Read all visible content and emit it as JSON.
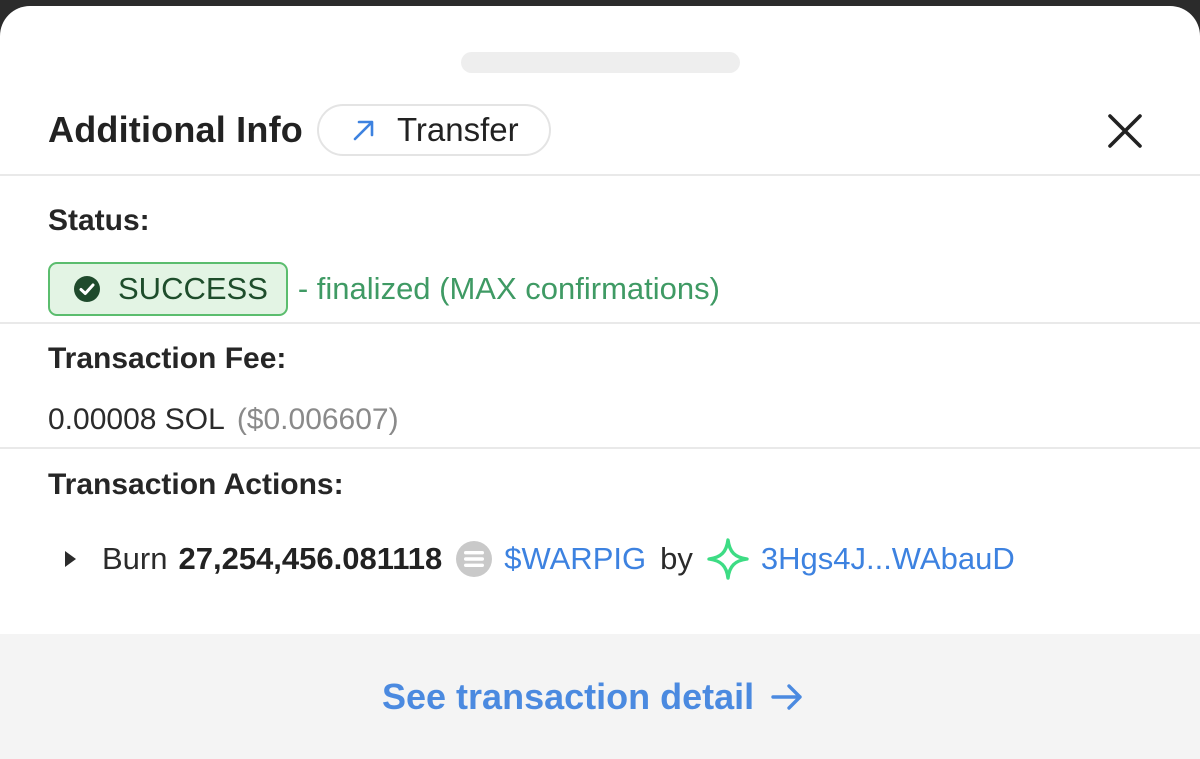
{
  "header": {
    "title": "Additional Info",
    "type_label": "Transfer",
    "type_icon": "arrow-up-right-icon",
    "close_icon": "close-icon"
  },
  "status": {
    "label": "Status:",
    "badge_text": "SUCCESS",
    "badge_icon": "check-circle-icon",
    "note": "- finalized (MAX confirmations)"
  },
  "fee": {
    "label": "Transaction Fee:",
    "amount": "0.00008 SOL",
    "usd": "($0.006607)"
  },
  "actions": {
    "label": "Transaction Actions:",
    "items": [
      {
        "verb": "Burn",
        "amount": "27,254,456.081118",
        "token_icon": "token-icon",
        "token": "$WARPIG",
        "by": "by",
        "account_icon": "sparkle-icon",
        "account": "3Hgs4J...WAbauD"
      }
    ]
  },
  "footer": {
    "link_label": "See transaction detail",
    "link_icon": "arrow-right-icon"
  },
  "colors": {
    "accent_blue": "#3d82e0",
    "success_green": "#3f9a64",
    "badge_bg": "#e3f4e4",
    "badge_border": "#5bbd6e",
    "sparkle_green": "#3ddc84"
  }
}
